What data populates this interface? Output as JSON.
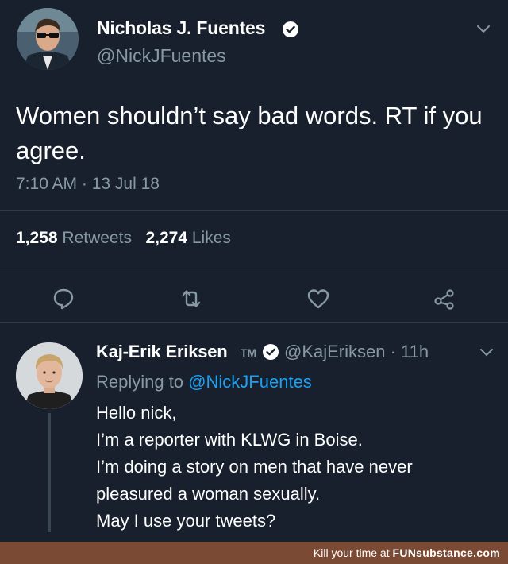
{
  "tweet": {
    "author_name": "Nicholas J. Fuentes",
    "handle": "@NickJFuentes",
    "text": "Women shouldn’t say bad words. RT if you agree.",
    "timestamp": "7:10 AM · 13 Jul 18",
    "retweets_count": "1,258",
    "retweets_label": "Retweets",
    "likes_count": "2,274",
    "likes_label": "Likes",
    "actions": [
      "reply-icon",
      "retweet-icon",
      "like-icon",
      "share-icon"
    ]
  },
  "reply": {
    "author_name": "Kaj-Erik Eriksen",
    "tm": "TM",
    "handle_time": "@KajEriksen · 11h",
    "replying_prefix": "Replying to",
    "replying_to": "@NickJFuentes",
    "lines": [
      "Hello nick,",
      "I’m a reporter with KLWG in Boise.",
      "I’m doing a story on men that have never",
      "pleasured a woman sexually.",
      "May I use your tweets?"
    ]
  },
  "footer": {
    "prefix": "Kill your time at",
    "brand": "FUNsubstance.com"
  },
  "colors": {
    "background": "#17202c",
    "secondary_text": "#8899a6",
    "link": "#1da1f2",
    "footer_bar": "#7b4a34"
  }
}
